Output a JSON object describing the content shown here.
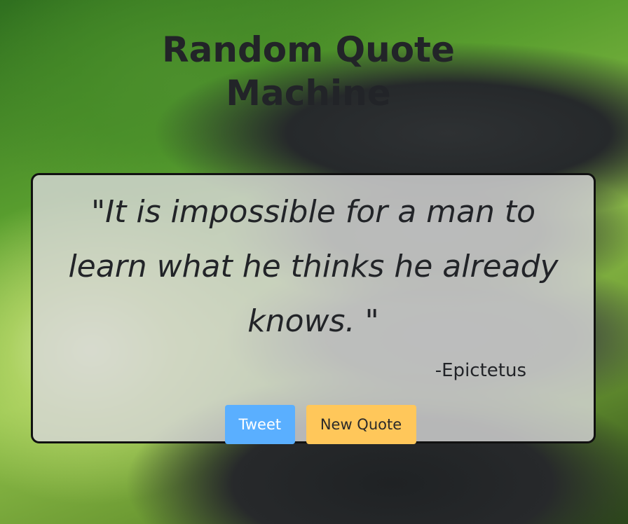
{
  "header": {
    "title_line1": "Random Quote",
    "title_line2": "Machine"
  },
  "quote": {
    "text": "\"It is impossible for a man to learn what he thinks he already knows. \"",
    "author": "-Epictetus"
  },
  "actions": {
    "tweet_label": "Tweet",
    "new_quote_label": "New Quote"
  },
  "colors": {
    "tweet_button": "#5aafff",
    "new_quote_button": "#ffc75a",
    "box_border": "#111111",
    "text": "#222428"
  }
}
